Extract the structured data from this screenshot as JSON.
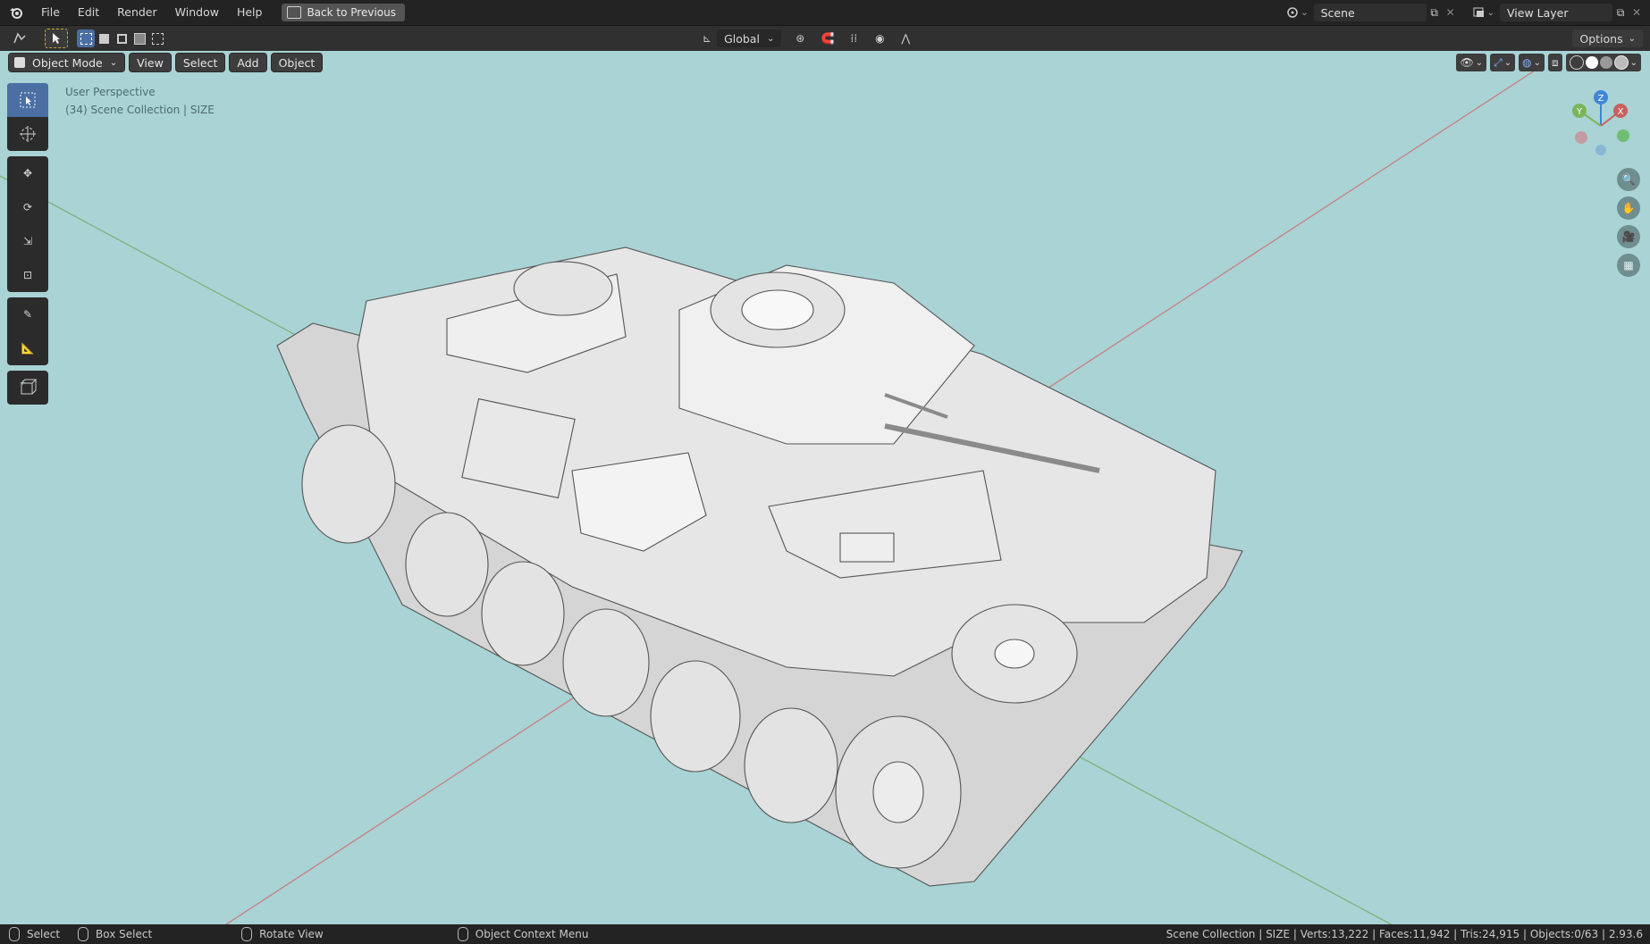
{
  "topbar": {
    "menus": [
      "File",
      "Edit",
      "Render",
      "Window",
      "Help"
    ],
    "back_label": "Back to Previous",
    "scene_label": "Scene",
    "view_layer_label": "View Layer"
  },
  "toolbar": {
    "orientation_label": "Global",
    "options_label": "Options"
  },
  "viewport_header": {
    "mode_label": "Object Mode",
    "menus": [
      "View",
      "Select",
      "Add",
      "Object"
    ]
  },
  "viewport": {
    "perspective_label": "User Perspective",
    "collection_label": "(34) Scene Collection | SIZE",
    "gizmo_axes": [
      "X",
      "Y",
      "Z"
    ]
  },
  "statusbar": {
    "select_label": "Select",
    "box_select_label": "Box Select",
    "rotate_label": "Rotate View",
    "context_label": "Object Context Menu",
    "stats": "Scene Collection | SIZE | Verts:13,222 | Faces:11,942 | Tris:24,915 | Objects:0/63 | 2.93.6"
  },
  "colors": {
    "viewport_bg": "#a9d3d5",
    "axis_x": "#c9605f",
    "axis_y": "#7ab55a",
    "axis_z": "#3f86d8",
    "active_tool": "#4b6fa3"
  }
}
